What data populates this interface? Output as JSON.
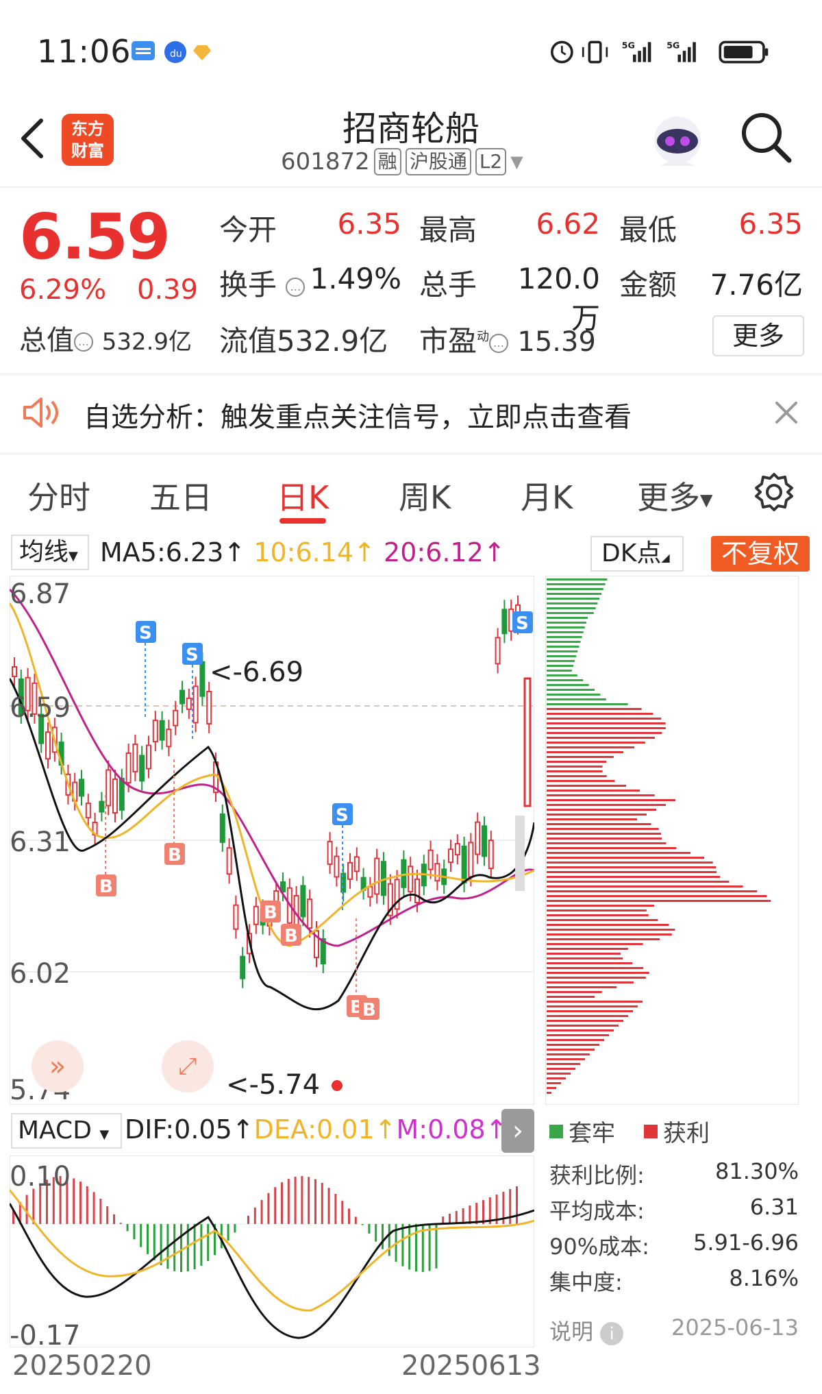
{
  "status_bar": {
    "time": "11:06",
    "net1": "5G",
    "net2": "5G"
  },
  "header": {
    "back_icon": "chevron-left-icon",
    "logo_text": "东方财富",
    "title": "招商轮船",
    "code": "601872",
    "tags": [
      "融",
      "沪股通",
      "L2"
    ],
    "search_icon": "search-icon"
  },
  "quote": {
    "price": "6.59",
    "change_pct": "6.29%",
    "change": "0.39",
    "rows": [
      [
        {
          "label": "今开",
          "value": "6.35",
          "color": "red"
        },
        {
          "label": "最高",
          "value": "6.62",
          "color": "red"
        },
        {
          "label": "最低",
          "value": "6.35",
          "color": "red"
        }
      ],
      [
        {
          "label": "换手",
          "value": "1.49%",
          "info": true
        },
        {
          "label": "总手",
          "value": "120.0万"
        },
        {
          "label": "金额",
          "value": "7.76亿"
        }
      ]
    ],
    "row3": {
      "total_mv_label": "总值",
      "total_mv": "532.9亿",
      "float_mv_label": "流值",
      "float_mv": "532.9亿",
      "pe_label": "市盈",
      "pe_sup": "动",
      "pe": "15.39"
    },
    "more_label": "更多"
  },
  "banner": {
    "text": "自选分析：触发重点关注信号，立即点击查看"
  },
  "tabs": [
    "分时",
    "五日",
    "日K",
    "周K",
    "月K",
    "更多"
  ],
  "active_tab": "日K",
  "ma": {
    "select_label": "均线",
    "ma5": "MA5:6.23↑",
    "ma10": "10:6.14↑",
    "ma20": "20:6.12↑",
    "ma10_color": "#f0b428",
    "ma20_color": "#c0208a",
    "dk_label": "DK点",
    "fq_label": "不复权"
  },
  "kline": {
    "y_labels": [
      "6.87",
      "6.59",
      "6.31",
      "6.02",
      "5.74"
    ],
    "high_marker": "<-6.69",
    "low_marker": "<-5.74"
  },
  "macd": {
    "select_label": "MACD",
    "dif": "DIF:0.05↑",
    "dea": "DEA:0.01↑",
    "m": "M:0.08↑",
    "y_top": "0.10",
    "y_bottom": "-0.17",
    "date_start": "20250220",
    "date_end": "20250613"
  },
  "chip": {
    "legend_trap": "套牢",
    "legend_profit": "获利",
    "trap_color": "#3aa64a",
    "profit_color": "#e0333a",
    "stats": [
      {
        "label": "获利比例:",
        "value": "81.30%"
      },
      {
        "label": "平均成本:",
        "value": "6.31"
      },
      {
        "label": "90%成本:",
        "value": "5.91-6.96"
      },
      {
        "label": "集中度:",
        "value": "8.16%"
      }
    ],
    "note_label": "说明",
    "date": "2025-06-13"
  }
}
